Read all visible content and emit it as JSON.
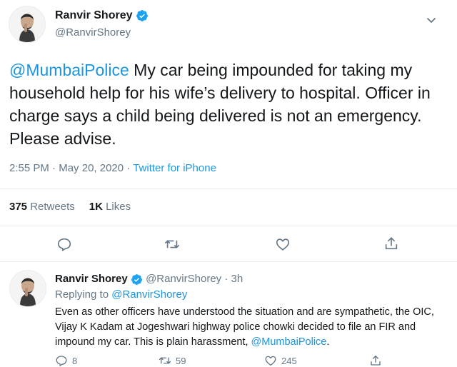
{
  "main_tweet": {
    "author_name": "Ranvir Shorey",
    "author_handle": "@RanvirShorey",
    "mention": "@MumbaiPolice",
    "text": " My car being impounded for taking my household help for his wife’s delivery to hospital. Officer in charge says a child being delivered is not an emergency. Please advise.",
    "time": "2:55 PM",
    "date": "May 20, 2020",
    "separator": "·",
    "source": "Twitter for iPhone",
    "retweets_count": "375",
    "retweets_label": "Retweets",
    "likes_count": "1K",
    "likes_label": "Likes"
  },
  "reply_tweet": {
    "author_name": "Ranvir Shorey",
    "author_handle": "@RanvirShorey",
    "age": "· 3h",
    "replying_label": "Replying to",
    "replying_to": "@RanvirShorey",
    "text": "Even as other officers have understood the situation and are sympathetic, the OIC, Vijay K Kadam at Jogeshwari highway police chowki decided to file an FIR and impound my car. This is plain harassment, ",
    "mention": "@MumbaiPolice",
    "text_end": ".",
    "reply_count": "8",
    "retweet_count": "59",
    "like_count": "245"
  },
  "icons": {
    "verified": "verified-badge-icon",
    "caret": "chevron-down-icon",
    "reply": "comment-icon",
    "retweet": "retweet-icon",
    "like": "heart-icon",
    "share": "share-icon"
  },
  "colors": {
    "link": "#1b95e0",
    "muted": "#657786",
    "text": "#14171a",
    "divider": "#e6ecf0"
  }
}
